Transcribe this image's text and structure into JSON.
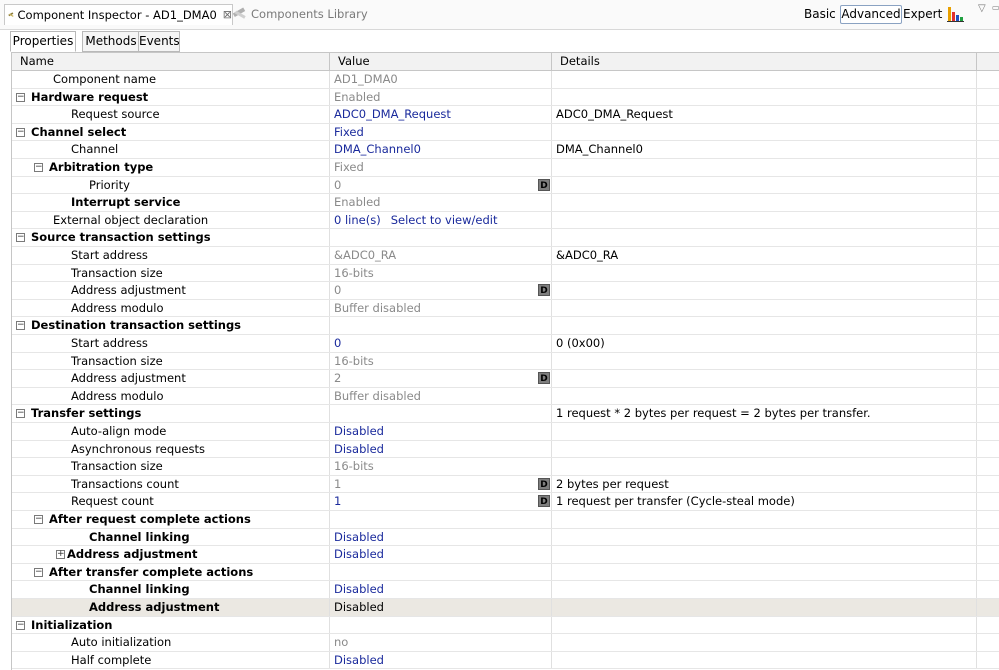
{
  "tabs": {
    "inspector": "Component Inspector - AD1_DMA0",
    "library": "Components Library"
  },
  "modes": {
    "basic": "Basic",
    "advanced": "Advanced",
    "expert": "Expert"
  },
  "subtabs": {
    "properties": "Properties",
    "methods": "Methods",
    "events": "Events"
  },
  "columns": {
    "name": "Name",
    "value": "Value",
    "details": "Details"
  },
  "rows": [
    {
      "name": "Component name",
      "indent": 1,
      "bold": false,
      "toggle": "",
      "value": "AD1_DMA0",
      "vstyle": "ro",
      "dbtn": false,
      "details": ""
    },
    {
      "name": "Hardware request",
      "indent": 0,
      "bold": true,
      "toggle": "−",
      "value": "Enabled",
      "vstyle": "ro",
      "dbtn": false,
      "details": ""
    },
    {
      "name": "Request source",
      "indent": 2,
      "bold": false,
      "toggle": "",
      "value": "ADC0_DMA_Request",
      "vstyle": "link",
      "dbtn": false,
      "details": "ADC0_DMA_Request"
    },
    {
      "name": "Channel select",
      "indent": 0,
      "bold": true,
      "toggle": "−",
      "value": "Fixed",
      "vstyle": "link",
      "dbtn": false,
      "details": ""
    },
    {
      "name": "Channel",
      "indent": 2,
      "bold": false,
      "toggle": "",
      "value": "DMA_Channel0",
      "vstyle": "link",
      "dbtn": false,
      "details": "DMA_Channel0"
    },
    {
      "name": "Arbitration type",
      "indent": 1,
      "bold": true,
      "toggle": "−",
      "value": "Fixed",
      "vstyle": "ro",
      "dbtn": false,
      "details": ""
    },
    {
      "name": "Priority",
      "indent": 3,
      "bold": false,
      "toggle": "",
      "value": "0",
      "vstyle": "ro",
      "dbtn": true,
      "details": ""
    },
    {
      "name": "Interrupt service",
      "indent": 2,
      "bold": true,
      "toggle": "",
      "value": "Enabled",
      "vstyle": "ro",
      "dbtn": false,
      "details": ""
    },
    {
      "name": "External object declaration",
      "indent": 1,
      "bold": false,
      "toggle": "",
      "value": "0 line(s)",
      "vstyle": "link",
      "extra": "Select to view/edit",
      "dbtn": false,
      "details": ""
    },
    {
      "name": "Source transaction settings",
      "indent": 0,
      "bold": true,
      "toggle": "−",
      "value": "",
      "vstyle": "ro",
      "dbtn": false,
      "details": ""
    },
    {
      "name": "Start address",
      "indent": 2,
      "bold": false,
      "toggle": "",
      "value": "&ADC0_RA",
      "vstyle": "ro",
      "dbtn": false,
      "details": "&ADC0_RA"
    },
    {
      "name": "Transaction size",
      "indent": 2,
      "bold": false,
      "toggle": "",
      "value": "16-bits",
      "vstyle": "ro",
      "dbtn": false,
      "details": ""
    },
    {
      "name": "Address adjustment",
      "indent": 2,
      "bold": false,
      "toggle": "",
      "value": "0",
      "vstyle": "ro",
      "dbtn": true,
      "details": ""
    },
    {
      "name": "Address modulo",
      "indent": 2,
      "bold": false,
      "toggle": "",
      "value": "Buffer disabled",
      "vstyle": "ro",
      "dbtn": false,
      "details": ""
    },
    {
      "name": "Destination transaction settings",
      "indent": 0,
      "bold": true,
      "toggle": "−",
      "value": "",
      "vstyle": "ro",
      "dbtn": false,
      "details": ""
    },
    {
      "name": "Start address",
      "indent": 2,
      "bold": false,
      "toggle": "",
      "value": "0",
      "vstyle": "link",
      "dbtn": false,
      "details": "0 (0x00)"
    },
    {
      "name": "Transaction size",
      "indent": 2,
      "bold": false,
      "toggle": "",
      "value": "16-bits",
      "vstyle": "ro",
      "dbtn": false,
      "details": ""
    },
    {
      "name": "Address adjustment",
      "indent": 2,
      "bold": false,
      "toggle": "",
      "value": "2",
      "vstyle": "ro",
      "dbtn": true,
      "details": ""
    },
    {
      "name": "Address modulo",
      "indent": 2,
      "bold": false,
      "toggle": "",
      "value": "Buffer disabled",
      "vstyle": "ro",
      "dbtn": false,
      "details": ""
    },
    {
      "name": "Transfer settings",
      "indent": 0,
      "bold": true,
      "toggle": "−",
      "value": "",
      "vstyle": "ro",
      "dbtn": false,
      "details": "1 request * 2 bytes per request = 2 bytes per transfer."
    },
    {
      "name": "Auto-align mode",
      "indent": 2,
      "bold": false,
      "toggle": "",
      "value": "Disabled",
      "vstyle": "link",
      "dbtn": false,
      "details": ""
    },
    {
      "name": "Asynchronous requests",
      "indent": 2,
      "bold": false,
      "toggle": "",
      "value": "Disabled",
      "vstyle": "link",
      "dbtn": false,
      "details": ""
    },
    {
      "name": "Transaction size",
      "indent": 2,
      "bold": false,
      "toggle": "",
      "value": "16-bits",
      "vstyle": "ro",
      "dbtn": false,
      "details": ""
    },
    {
      "name": "Transactions count",
      "indent": 2,
      "bold": false,
      "toggle": "",
      "value": "1",
      "vstyle": "ro",
      "dbtn": true,
      "details": "2 bytes per request"
    },
    {
      "name": "Request count",
      "indent": 2,
      "bold": false,
      "toggle": "",
      "value": "1",
      "vstyle": "link",
      "dbtn": true,
      "details": "1 request per transfer (Cycle-steal mode)"
    },
    {
      "name": "After request complete actions",
      "indent": 1,
      "bold": true,
      "toggle": "−",
      "value": "",
      "vstyle": "ro",
      "dbtn": false,
      "details": ""
    },
    {
      "name": "Channel linking",
      "indent": 3,
      "bold": true,
      "toggle": "",
      "value": "Disabled",
      "vstyle": "link",
      "dbtn": false,
      "details": ""
    },
    {
      "name": "Address adjustment",
      "indent": 2,
      "bold": true,
      "toggle": "+",
      "value": "Disabled",
      "vstyle": "link",
      "dbtn": false,
      "details": ""
    },
    {
      "name": "After transfer complete actions",
      "indent": 1,
      "bold": true,
      "toggle": "−",
      "value": "",
      "vstyle": "ro",
      "dbtn": false,
      "details": ""
    },
    {
      "name": "Channel linking",
      "indent": 3,
      "bold": true,
      "toggle": "",
      "value": "Disabled",
      "vstyle": "link",
      "dbtn": false,
      "details": ""
    },
    {
      "name": "Address adjustment",
      "indent": 3,
      "bold": true,
      "toggle": "",
      "value": "Disabled",
      "vstyle": "plain",
      "dbtn": false,
      "details": "",
      "selected": true
    },
    {
      "name": "Initialization",
      "indent": 0,
      "bold": true,
      "toggle": "−",
      "value": "",
      "vstyle": "ro",
      "dbtn": false,
      "details": ""
    },
    {
      "name": "Auto initialization",
      "indent": 2,
      "bold": false,
      "toggle": "",
      "value": "no",
      "vstyle": "ro",
      "dbtn": false,
      "details": ""
    },
    {
      "name": "Half complete",
      "indent": 2,
      "bold": false,
      "toggle": "",
      "value": "Disabled",
      "vstyle": "link",
      "dbtn": false,
      "details": ""
    }
  ],
  "dbtn_label": "D",
  "colors": {
    "link": "#1a2a9c",
    "readonly": "#8a8a8a",
    "selected_row": "#ebe8e2"
  }
}
